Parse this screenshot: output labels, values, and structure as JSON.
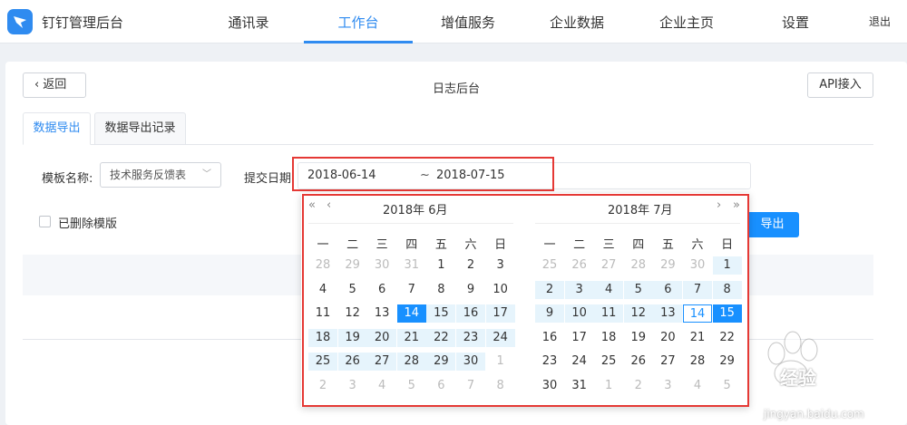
{
  "app": {
    "brand": "钉钉管理后台"
  },
  "nav": {
    "items": [
      {
        "label": "通讯录",
        "active": false
      },
      {
        "label": "工作台",
        "active": true
      },
      {
        "label": "增值服务",
        "active": false
      },
      {
        "label": "企业数据",
        "active": false
      },
      {
        "label": "企业主页",
        "active": false
      },
      {
        "label": "设置",
        "active": false
      }
    ],
    "logout": "退出"
  },
  "page": {
    "back_label": "返回",
    "title": "日志后台",
    "api_label": "API接入",
    "tabs": [
      {
        "label": "数据导出",
        "active": true
      },
      {
        "label": "数据导出记录",
        "active": false
      }
    ]
  },
  "filters": {
    "template_label": "模板名称:",
    "template_value": "技术服务反馈表",
    "date_label": "提交日期:",
    "date_start": "2018-06-14",
    "date_sep": "~",
    "date_end": "2018-07-15",
    "deleted_label": "已删除模版",
    "deleted_checked": false,
    "export_label": "导出"
  },
  "calendar": {
    "nav": {
      "prev_year": "«",
      "prev_month": "‹",
      "next_month": "›",
      "next_year": "»"
    },
    "weekdays": [
      "一",
      "二",
      "三",
      "四",
      "五",
      "六",
      "日"
    ],
    "months": [
      {
        "title": "2018年 6月",
        "weeks": [
          [
            "28",
            "29",
            "30",
            "31",
            "1",
            "2",
            "3"
          ],
          [
            "4",
            "5",
            "6",
            "7",
            "8",
            "9",
            "10"
          ],
          [
            "11",
            "12",
            "13",
            "14",
            "15",
            "16",
            "17"
          ],
          [
            "18",
            "19",
            "20",
            "21",
            "22",
            "23",
            "24"
          ],
          [
            "25",
            "26",
            "27",
            "28",
            "29",
            "30",
            "1"
          ],
          [
            "2",
            "3",
            "4",
            "5",
            "6",
            "7",
            "8"
          ]
        ]
      },
      {
        "title": "2018年 7月",
        "weeks": [
          [
            "25",
            "26",
            "27",
            "28",
            "29",
            "30",
            "1"
          ],
          [
            "2",
            "3",
            "4",
            "5",
            "6",
            "7",
            "8"
          ],
          [
            "9",
            "10",
            "11",
            "12",
            "13",
            "14",
            "15"
          ],
          [
            "16",
            "17",
            "18",
            "19",
            "20",
            "21",
            "22"
          ],
          [
            "23",
            "24",
            "25",
            "26",
            "27",
            "28",
            "29"
          ],
          [
            "30",
            "31",
            "1",
            "2",
            "3",
            "4",
            "5"
          ]
        ]
      }
    ],
    "range_start": "2018-06-14",
    "range_end": "2018-07-15",
    "today": "2018-07-14"
  },
  "watermark": {
    "text": "经验",
    "url": "jingyan.baidu.com"
  },
  "colors": {
    "accent": "#1890ff",
    "nav_active": "#2f8bf0",
    "highlight": "#e53935",
    "range_bg": "#e6f4fc"
  }
}
